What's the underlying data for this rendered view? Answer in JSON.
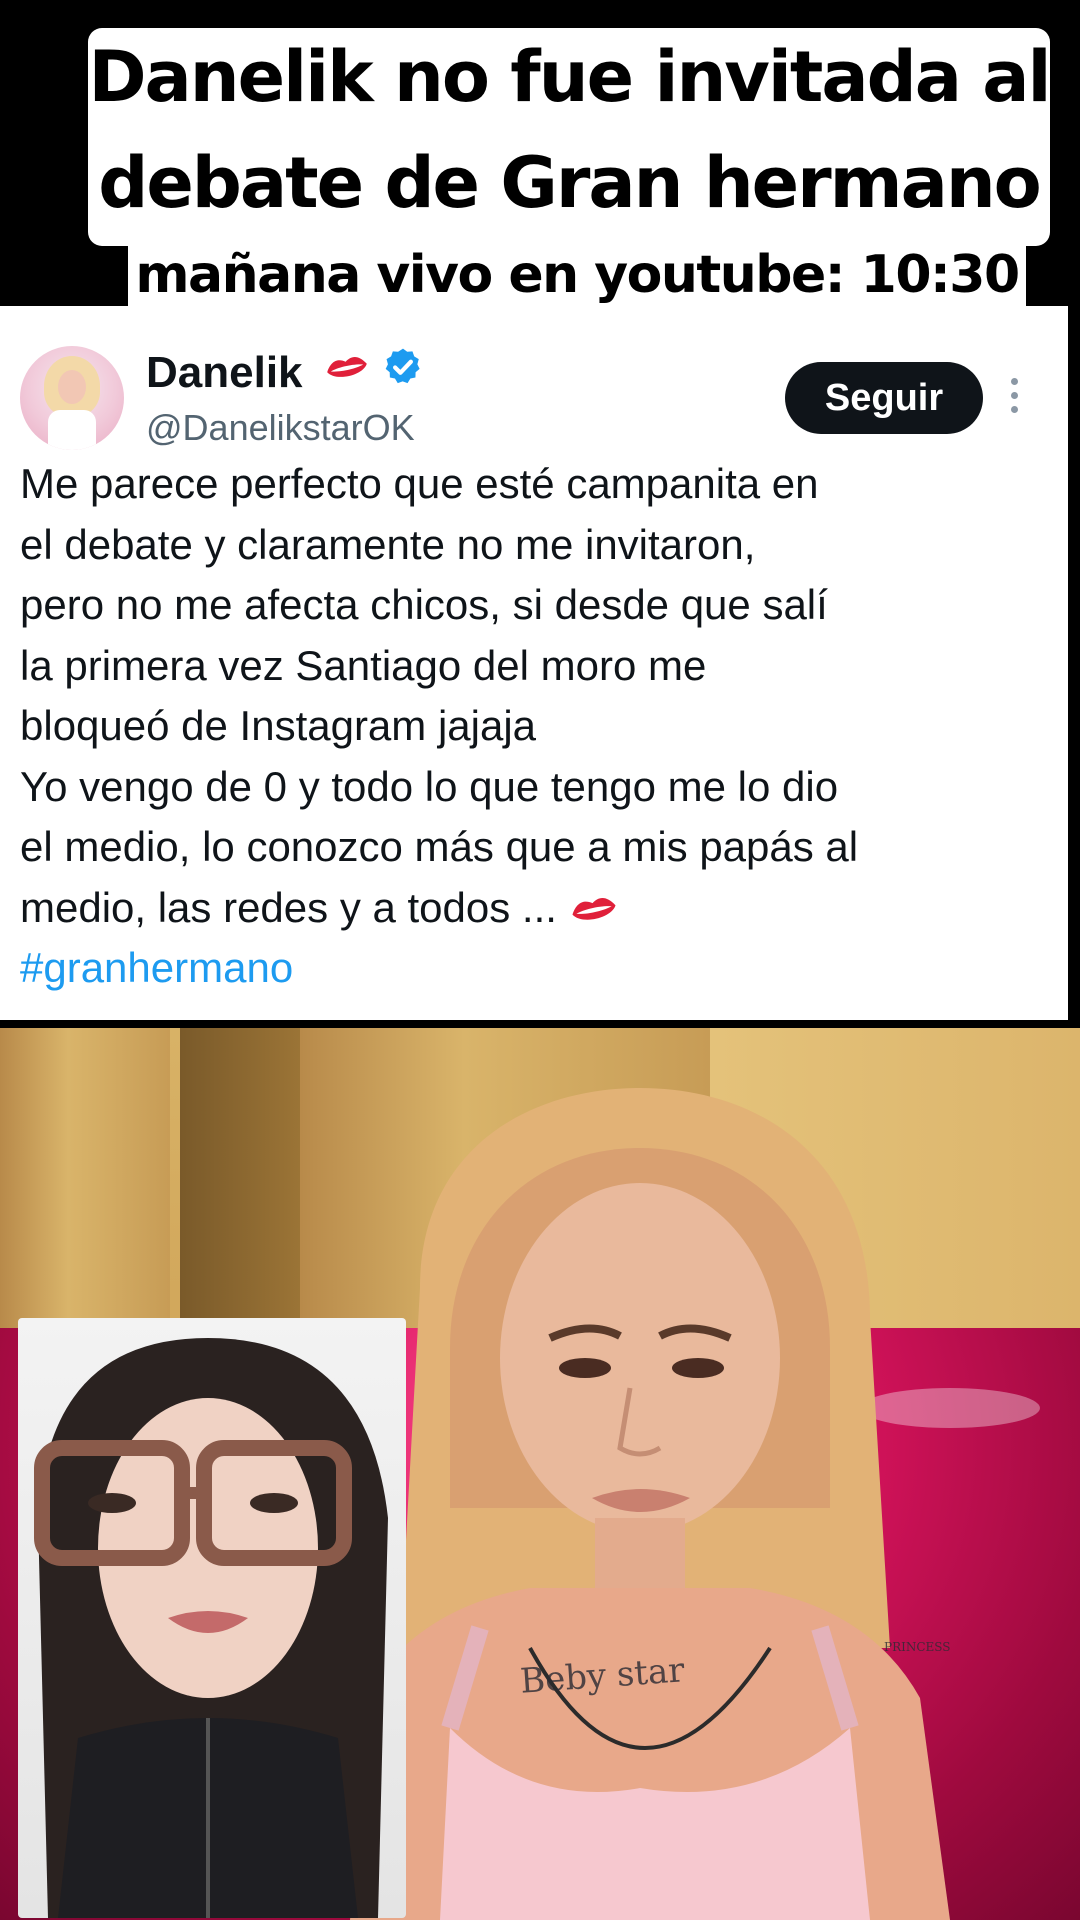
{
  "caption": {
    "line1": "Danelik no fue invitada al",
    "line2": "debate de Gran hermano",
    "subline": "mañana vivo en youtube: 10:30"
  },
  "tweet": {
    "display_name": "Danelik",
    "handle": "@DanelikstarOK",
    "follow_label": "Seguir",
    "lines": [
      "Me parece perfecto que esté campanita en",
      "el debate y claramente no me invitaron,",
      "pero no me afecta chicos, si desde que salí",
      "la primera vez Santiago del moro me",
      "bloqueó de Instagram jajaja",
      "Yo vengo de 0 y todo lo que tengo me lo dio",
      "el medio, lo conozco más que a mis papás al",
      "medio, las redes y a todos ..."
    ],
    "hashtag": "#granhermano",
    "icons": [
      "kiss-lips-icon",
      "verified-badge-icon",
      "more-options-icon"
    ]
  },
  "video": {
    "tattoo_text": "Beby star",
    "tattoo_small": "PRINCESS"
  },
  "colors": {
    "verified": "#1d9bf0",
    "hashtag": "#1d9bf0",
    "button": "#0f1419",
    "lips": "#e0203a",
    "sofa": "#d6135c"
  }
}
